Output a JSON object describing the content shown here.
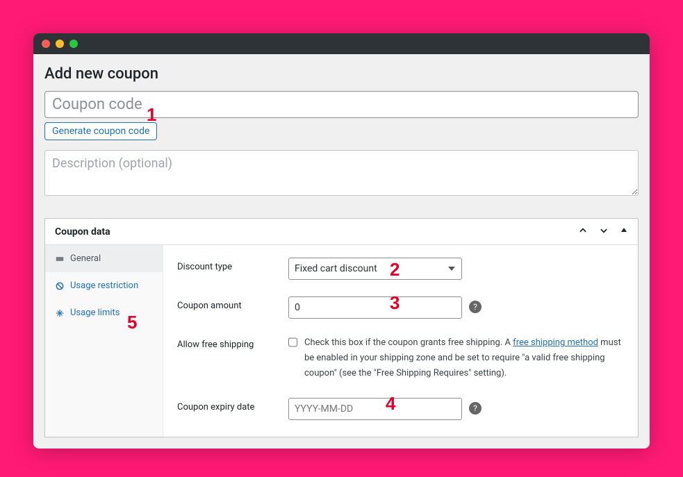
{
  "page": {
    "title": "Add new coupon"
  },
  "code": {
    "placeholder": "Coupon code",
    "generate_label": "Generate coupon code"
  },
  "description": {
    "placeholder": "Description (optional)"
  },
  "panel": {
    "title": "Coupon data"
  },
  "tabs": {
    "general": "General",
    "restriction": "Usage restriction",
    "limits": "Usage limits"
  },
  "fields": {
    "discount_type": {
      "label": "Discount type",
      "selected": "Fixed cart discount"
    },
    "coupon_amount": {
      "label": "Coupon amount",
      "value": "0"
    },
    "free_shipping": {
      "label": "Allow free shipping",
      "hint_before": "Check this box if the coupon grants free shipping. A ",
      "hint_link": "free shipping method",
      "hint_after": " must be enabled in your shipping zone and be set to require \"a valid free shipping coupon\" (see the \"Free Shipping Requires\" setting)."
    },
    "expiry": {
      "label": "Coupon expiry date",
      "placeholder": "YYYY-MM-DD"
    }
  },
  "annotations": {
    "a1": "1",
    "a2": "2",
    "a3": "3",
    "a4": "4",
    "a5": "5"
  }
}
